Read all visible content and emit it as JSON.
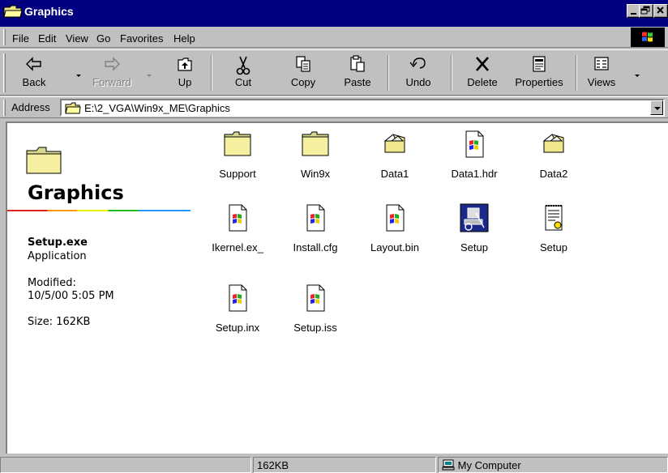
{
  "window": {
    "title": "Graphics"
  },
  "menu": [
    "File",
    "Edit",
    "View",
    "Go",
    "Favorites",
    "Help"
  ],
  "toolbar": {
    "back": "Back",
    "forward": "Forward",
    "up": "Up",
    "cut": "Cut",
    "copy": "Copy",
    "paste": "Paste",
    "undo": "Undo",
    "delete": "Delete",
    "properties": "Properties",
    "views": "Views"
  },
  "address": {
    "label": "Address",
    "value": "E:\\2_VGA\\Win9x_ME\\Graphics"
  },
  "sidebar": {
    "title": "Graphics",
    "file_name": "Setup.exe",
    "file_type": "Application",
    "modified_label": "Modified:",
    "modified_value": "10/5/00 5:05 PM",
    "size": "Size: 162KB"
  },
  "files": [
    {
      "name": "Support",
      "icon": "folder-icon"
    },
    {
      "name": "Win9x",
      "icon": "folder-icon"
    },
    {
      "name": "Data1",
      "icon": "cabinet-icon"
    },
    {
      "name": "Data1.hdr",
      "icon": "file-icon"
    },
    {
      "name": "Data2",
      "icon": "cabinet-icon"
    },
    {
      "name": "Ikernel.ex_",
      "icon": "file-icon"
    },
    {
      "name": "Install.cfg",
      "icon": "file-icon"
    },
    {
      "name": "Layout.bin",
      "icon": "file-icon"
    },
    {
      "name": "Setup",
      "icon": "setup-exe-icon"
    },
    {
      "name": "Setup",
      "icon": "setup-ini-icon"
    },
    {
      "name": "Setup.inx",
      "icon": "file-icon"
    },
    {
      "name": "Setup.iss",
      "icon": "file-icon"
    }
  ],
  "status": {
    "size": "162KB",
    "zone": "My Computer"
  }
}
